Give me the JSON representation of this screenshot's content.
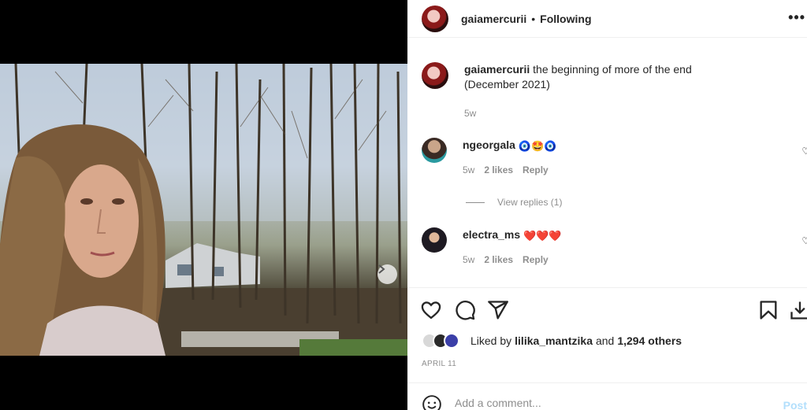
{
  "post": {
    "username": "gaiamercurii",
    "separator": "•",
    "follow_status": "Following",
    "more_label": "•••"
  },
  "caption": {
    "username": "gaiamercurii",
    "text": "the beginning of more of the end (December 2021)",
    "age": "5w"
  },
  "comments": [
    {
      "username": "ngeorgala",
      "text": "🧿🤩🧿",
      "age": "5w",
      "likes": "2 likes",
      "reply": "Reply"
    },
    {
      "username": "electra_ms",
      "text": "❤️❤️❤️",
      "age": "5w",
      "likes": "2 likes",
      "reply": "Reply"
    }
  ],
  "view_replies": "View replies (1)",
  "likes": {
    "prefix": "Liked by",
    "user": "lilika_mantzika",
    "conj": "and",
    "others": "1,294 others"
  },
  "date": "APRIL 11",
  "add_comment": {
    "placeholder": "Add a comment...",
    "post_label": "Post"
  },
  "carousel": {
    "slides": 10,
    "active": 1
  },
  "icons": [
    "heart-icon",
    "comment-icon",
    "share-icon",
    "bookmark-icon",
    "download-icon",
    "chevron-right-icon",
    "emoji-icon"
  ],
  "colors": {
    "link_blue": "#b2dffc",
    "muted": "#8e8e8e",
    "text": "#262626"
  }
}
